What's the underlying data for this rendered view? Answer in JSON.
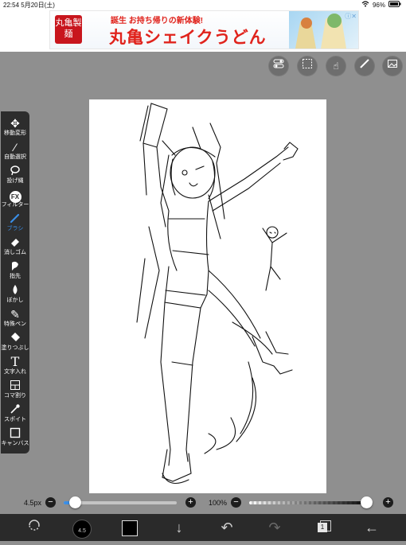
{
  "status_bar": {
    "time_date": "22:54  5月20日(土)",
    "battery": "96%"
  },
  "ad": {
    "seal_text": "丸亀製麺",
    "subtitle": "誕生  お持ち帰りの新体験!",
    "title": "丸亀シェイクうどん",
    "info_icon": "info-icon",
    "close_icon": "close-icon"
  },
  "top_tools": [
    {
      "name": "layer-toggle-icon"
    },
    {
      "name": "selection-icon"
    },
    {
      "name": "hand-tool-icon"
    },
    {
      "name": "ruler-icon"
    },
    {
      "name": "gallery-icon"
    }
  ],
  "tools": [
    {
      "label": "移動変形",
      "icon": "move-icon"
    },
    {
      "label": "自動選択",
      "icon": "magic-wand-icon"
    },
    {
      "label": "投げ縄",
      "icon": "lasso-icon"
    },
    {
      "label": "フィルター",
      "icon": "fx-icon",
      "glyph": "FX"
    },
    {
      "label": "ブラシ",
      "icon": "brush-icon"
    },
    {
      "label": "消しゴム",
      "icon": "eraser-icon"
    },
    {
      "label": "指先",
      "icon": "finger-icon"
    },
    {
      "label": "ぼかし",
      "icon": "blur-drop-icon"
    },
    {
      "label": "特殊ペン",
      "icon": "special-pen-icon"
    },
    {
      "label": "塗りつぶし",
      "icon": "fill-bucket-icon"
    },
    {
      "label": "文字入れ",
      "icon": "text-icon",
      "glyph": "T"
    },
    {
      "label": "コマ割り",
      "icon": "frame-divide-icon"
    },
    {
      "label": "スポイト",
      "icon": "eyedropper-icon"
    },
    {
      "label": "キャンバス",
      "icon": "canvas-icon"
    }
  ],
  "selected_tool": "ブラシ",
  "brush": {
    "size_label": "4.5px",
    "size_badge": "4.5",
    "size_fraction": 0.1
  },
  "opacity": {
    "label": "100%",
    "fraction": 1.0
  },
  "colors": {
    "current": "#000000",
    "accent": "#3a8ee6"
  },
  "bottom_actions": [
    {
      "name": "transform-rotate-icon"
    },
    {
      "name": "brush-size-indicator"
    },
    {
      "name": "color-swatch"
    },
    {
      "name": "download-icon"
    },
    {
      "name": "undo-icon"
    },
    {
      "name": "redo-icon"
    },
    {
      "name": "layers-icon",
      "badge": "1"
    },
    {
      "name": "back-icon"
    }
  ]
}
